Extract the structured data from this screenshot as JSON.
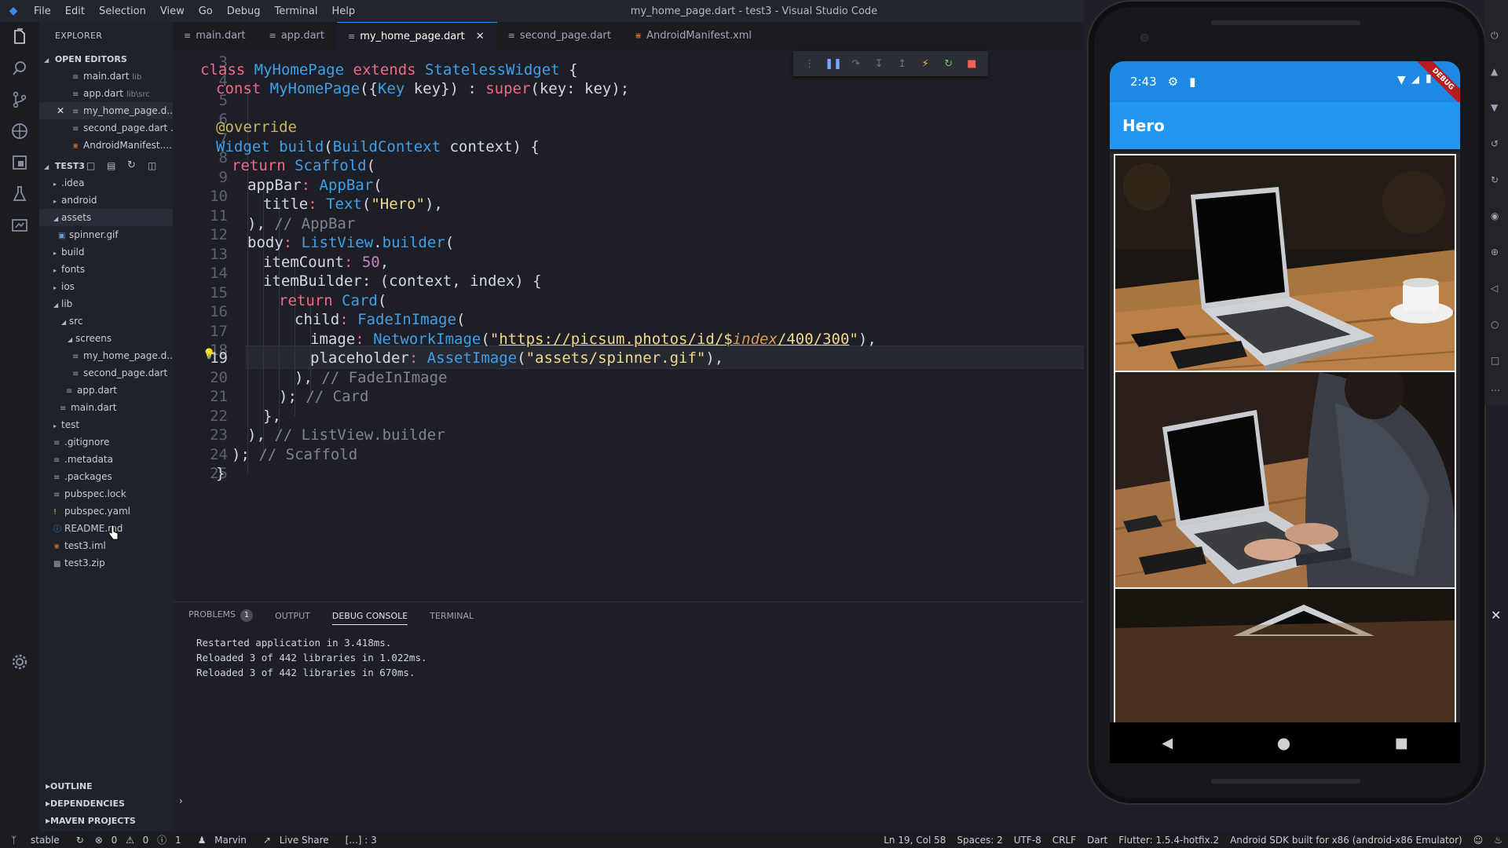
{
  "window": {
    "title": "my_home_page.dart - test3 - Visual Studio Code",
    "menu": [
      "File",
      "Edit",
      "Selection",
      "View",
      "Go",
      "Debug",
      "Terminal",
      "Help"
    ]
  },
  "explorer": {
    "header": "EXPLORER",
    "open_editors_label": "OPEN EDITORS",
    "open_editors": [
      {
        "name": "main.dart",
        "hint": "lib"
      },
      {
        "name": "app.dart",
        "hint": "lib\\src"
      },
      {
        "name": "my_home_page.d...",
        "hint": ""
      },
      {
        "name": "second_page.dart ...",
        "hint": ""
      },
      {
        "name": "AndroidManifest....",
        "hint": ""
      }
    ],
    "project_label": "TEST3",
    "tree": [
      ".idea",
      "android",
      "assets",
      "spinner.gif",
      "build",
      "fonts",
      "ios",
      "lib",
      "src",
      "screens",
      "my_home_page.d...",
      "second_page.dart",
      "app.dart",
      "main.dart",
      "test",
      ".gitignore",
      ".metadata",
      ".packages",
      "pubspec.lock",
      "pubspec.yaml",
      "README.md",
      "test3.iml",
      "test3.zip"
    ],
    "bottom_sections": [
      "OUTLINE",
      "DEPENDENCIES",
      "MAVEN PROJECTS"
    ]
  },
  "tabs": [
    {
      "label": "main.dart",
      "active": false
    },
    {
      "label": "app.dart",
      "active": false
    },
    {
      "label": "my_home_page.dart",
      "active": true
    },
    {
      "label": "second_page.dart",
      "active": false
    },
    {
      "label": "AndroidManifest.xml",
      "active": false
    }
  ],
  "editor": {
    "line_numbers": [
      "3",
      "4",
      "5",
      "6",
      "7",
      "8",
      "9",
      "10",
      "11",
      "12",
      "13",
      "14",
      "15",
      "16",
      "17",
      "18",
      "19",
      "20",
      "21",
      "22",
      "23",
      "24",
      "25"
    ],
    "current_line": "19",
    "code": {
      "l4": [
        "class",
        " ",
        "MyHomePage",
        " ",
        "extends",
        " ",
        "StatelessWidget",
        " {"
      ],
      "l5": [
        "const",
        " ",
        "MyHomePage",
        "({",
        "Key",
        " key}) : ",
        "super",
        "(key: key);"
      ],
      "l7": [
        "@override"
      ],
      "l8": [
        "Widget",
        " ",
        "build",
        "(",
        "BuildContext",
        " context) {"
      ],
      "l9": [
        "return",
        " ",
        "Scaffold",
        "("
      ],
      "l10": [
        "appBar",
        ": ",
        "AppBar",
        "("
      ],
      "l11": [
        "title",
        ": ",
        "Text",
        "(",
        "\"Hero\"",
        "),"
      ],
      "l12": [
        "), ",
        "// AppBar"
      ],
      "l13": [
        "body",
        ": ",
        "ListView",
        ".",
        "builder",
        "("
      ],
      "l14": [
        "itemCount",
        ": ",
        "50",
        ","
      ],
      "l15": [
        "itemBuilder",
        ": (context, index) {"
      ],
      "l16": [
        "return",
        " ",
        "Card",
        "("
      ],
      "l17": [
        "child",
        ": ",
        "FadeInImage",
        "("
      ],
      "l18": [
        "image",
        ": ",
        "NetworkImage",
        "(",
        "\"",
        "https://picsum.photos/id/$",
        "index",
        "/400/300",
        "\"",
        "),"
      ],
      "l19": [
        "placeholder",
        ": ",
        "AssetImage",
        "(",
        "\"assets/spinner.gif\"",
        "),"
      ],
      "l20": [
        "), ",
        "// FadeInImage"
      ],
      "l21": [
        "); ",
        "// Card"
      ],
      "l22": [
        "},"
      ],
      "l23": [
        "), ",
        "// ListView.builder"
      ],
      "l24": [
        "); ",
        "// Scaffold"
      ],
      "l25": [
        "}"
      ]
    }
  },
  "panel": {
    "tabs": [
      "PROBLEMS",
      "OUTPUT",
      "DEBUG CONSOLE",
      "TERMINAL"
    ],
    "problems_count": "1",
    "active_tab": "DEBUG CONSOLE",
    "console_lines": [
      "Restarted application in 3.418ms.",
      "Reloaded 3 of 442 libraries in 1.022ms.",
      "Reloaded 3 of 442 libraries in 670ms."
    ]
  },
  "statusbar": {
    "branch": "stable",
    "errors": "0",
    "warnings": "0",
    "infos": "1",
    "user": "Marvin",
    "live_share": "Live Share",
    "brackets": "[...] : 3",
    "position": "Ln 19, Col 58",
    "spaces": "Spaces: 2",
    "encoding": "UTF-8",
    "eol": "CRLF",
    "language": "Dart",
    "flutter": "Flutter: 1.5.4-hotfix.2",
    "device": "Android SDK built for x86 (android-x86 Emulator)"
  },
  "emulator": {
    "time": "2:43",
    "app_title": "Hero",
    "debug_banner": "DEBUG"
  },
  "colors": {
    "accent": "#3b8eea",
    "appbar": "#2196f3",
    "statusbar": "#1e88e5"
  }
}
